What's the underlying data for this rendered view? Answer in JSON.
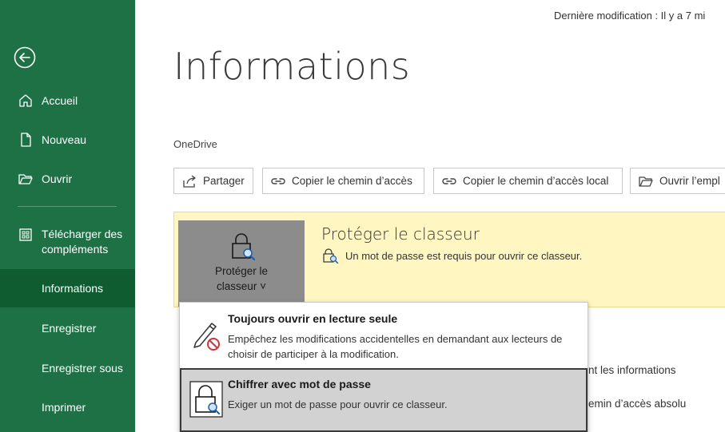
{
  "sidebar": {
    "items": [
      {
        "label": "Accueil",
        "icon": "home-icon"
      },
      {
        "label": "Nouveau",
        "icon": "new-document-icon"
      },
      {
        "label": "Ouvrir",
        "icon": "folder-open-icon"
      },
      {
        "label": "Télécharger des compléments",
        "icon": "store-icon"
      },
      {
        "label": "Informations"
      },
      {
        "label": "Enregistrer"
      },
      {
        "label": "Enregistrer sous"
      },
      {
        "label": "Imprimer"
      }
    ]
  },
  "header": {
    "last_modified": "Dernière modification : Il y a 7 mi",
    "title": "Informations",
    "location": "OneDrive"
  },
  "actions": {
    "share": "Partager",
    "copy_path": "Copier le chemin d’accès",
    "copy_local_path": "Copier le chemin d’accès local",
    "open_location": "Ouvrir l’empl"
  },
  "protect": {
    "button_line1": "Protéger le",
    "button_line2": "classeur ˅",
    "title": "Protéger le classeur",
    "description": "Un mot de passe est requis pour ouvrir ce classeur."
  },
  "behind": {
    "text1": "nt les informations",
    "text2": "emin d’accès absolu"
  },
  "menu": {
    "items": [
      {
        "title": "Toujours ouvrir en lecture seule",
        "description": "Empêchez les modifications accidentelles en demandant aux lecteurs de choisir de participer à la modification."
      },
      {
        "title": "Chiffrer avec mot de passe",
        "description": "Exiger un mot de passe pour ouvrir ce classeur."
      }
    ]
  },
  "colors": {
    "sidebar_bg": "#1e7145",
    "sidebar_active": "#0e5c2f",
    "protect_panel": "#fff6c2",
    "protect_button": "#8c8c8c"
  }
}
